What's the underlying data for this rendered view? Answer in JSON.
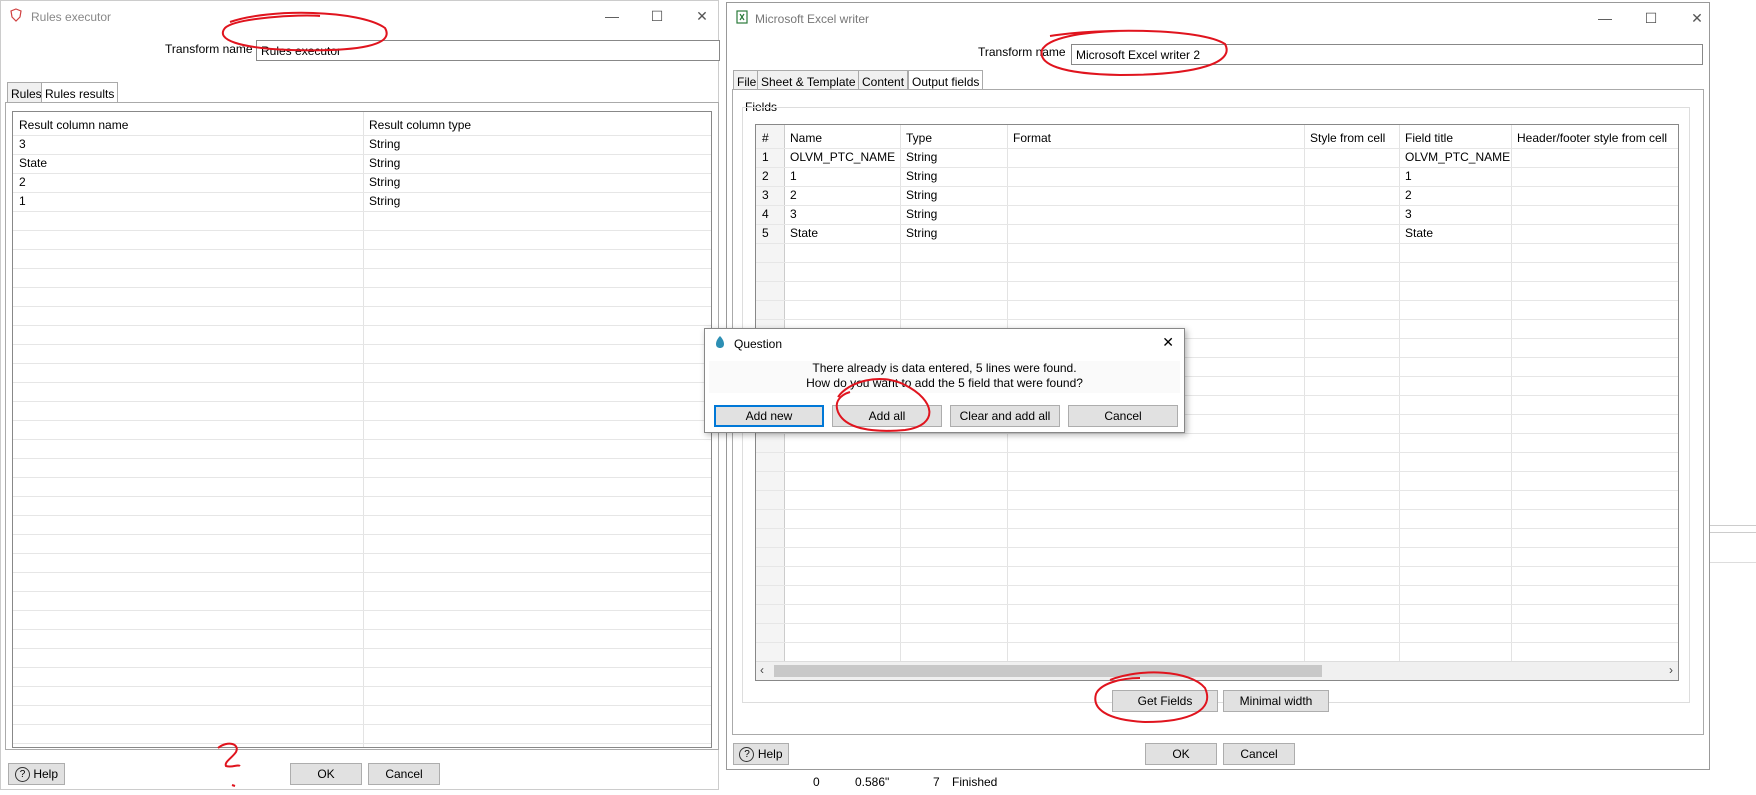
{
  "rules_window": {
    "title": "Rules executor",
    "transform_label": "Transform name",
    "transform_value": "Rules executor",
    "tabs": [
      "Rules",
      "Rules results"
    ],
    "columns": [
      "Result column name",
      "Result column type"
    ],
    "rows": [
      [
        "3",
        "String"
      ],
      [
        "State",
        "String"
      ],
      [
        "2",
        "String"
      ],
      [
        "1",
        "String"
      ]
    ],
    "help_label": "Help",
    "ok_label": "OK",
    "cancel_label": "Cancel"
  },
  "excel_window": {
    "title": "Microsoft Excel writer",
    "transform_label": "Transform name",
    "transform_value": "Microsoft Excel writer 2",
    "tabs": [
      "File",
      "Sheet & Template",
      "Content",
      "Output fields"
    ],
    "fields_group_label": "Fields",
    "columns": [
      "#",
      "Name",
      "Type",
      "Format",
      "Style from cell",
      "Field title",
      "Header/footer style from cell"
    ],
    "rows": [
      [
        "1",
        "OLVM_PTC_NAME",
        "String",
        "",
        "",
        "OLVM_PTC_NAME",
        ""
      ],
      [
        "2",
        "1",
        "String",
        "",
        "",
        "1",
        ""
      ],
      [
        "3",
        "2",
        "String",
        "",
        "",
        "2",
        ""
      ],
      [
        "4",
        "3",
        "String",
        "",
        "",
        "3",
        ""
      ],
      [
        "5",
        "State",
        "String",
        "",
        "",
        "State",
        ""
      ]
    ],
    "get_fields_label": "Get Fields",
    "minimal_width_label": "Minimal width",
    "help_label": "Help",
    "ok_label": "OK",
    "cancel_label": "Cancel"
  },
  "question_dialog": {
    "title": "Question",
    "line1": "There already is data entered, 5 lines were found.",
    "line2": "How do you want to add the 5 field that were found?",
    "buttons": [
      "Add new",
      "Add all",
      "Clear and add all",
      "Cancel"
    ]
  },
  "background_status": {
    "values": [
      "0",
      "0.586\"",
      "7",
      "Finished"
    ]
  },
  "annotation_color": "#e0141e"
}
